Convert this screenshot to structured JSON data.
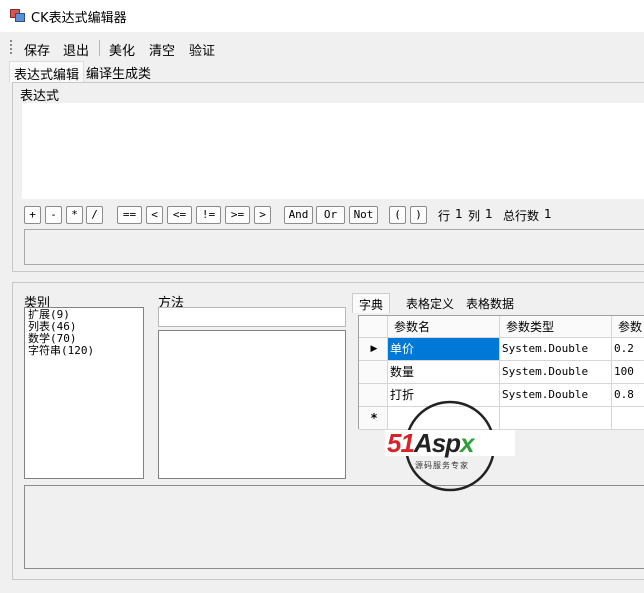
{
  "window": {
    "title": "CK表达式编辑器"
  },
  "menu": {
    "items": [
      "保存",
      "退出",
      "美化",
      "清空",
      "验证"
    ]
  },
  "tabs": [
    "表达式编辑",
    "编译生成类"
  ],
  "expression": {
    "group_label": "表达式",
    "operators": [
      "+",
      "-",
      "*",
      "/",
      "==",
      "<",
      "<=",
      "!=",
      ">=",
      ">",
      "And",
      "Or",
      "Not",
      "(",
      ")"
    ],
    "position": {
      "row_label": "行",
      "row": "1",
      "col_label": "列",
      "col": "1",
      "total_label": "总行数",
      "total": "1"
    }
  },
  "category": {
    "label": "类别",
    "items": [
      "扩展(9)",
      "列表(46)",
      "数学(70)",
      "字符串(120)"
    ]
  },
  "method": {
    "label": "方法",
    "search_value": ""
  },
  "right_tabs": [
    "字典",
    "表格定义",
    "表格数据"
  ],
  "grid": {
    "headers": [
      "参数名",
      "参数类型",
      "参数"
    ],
    "rows": [
      {
        "name": "单价",
        "type": "System.Double",
        "value": "0.2"
      },
      {
        "name": "数量",
        "type": "System.Double",
        "value": "100"
      },
      {
        "name": "打折",
        "type": "System.Double",
        "value": "0.8"
      }
    ],
    "new_row_marker": "*",
    "current_row_marker": "▶"
  },
  "watermark": {
    "brand": "51Aspx",
    "tagline": "源码服务专家"
  },
  "colors": {
    "selection": "#0078d7",
    "watermark_red": "#d8232a",
    "watermark_green": "#2e9f3a"
  }
}
